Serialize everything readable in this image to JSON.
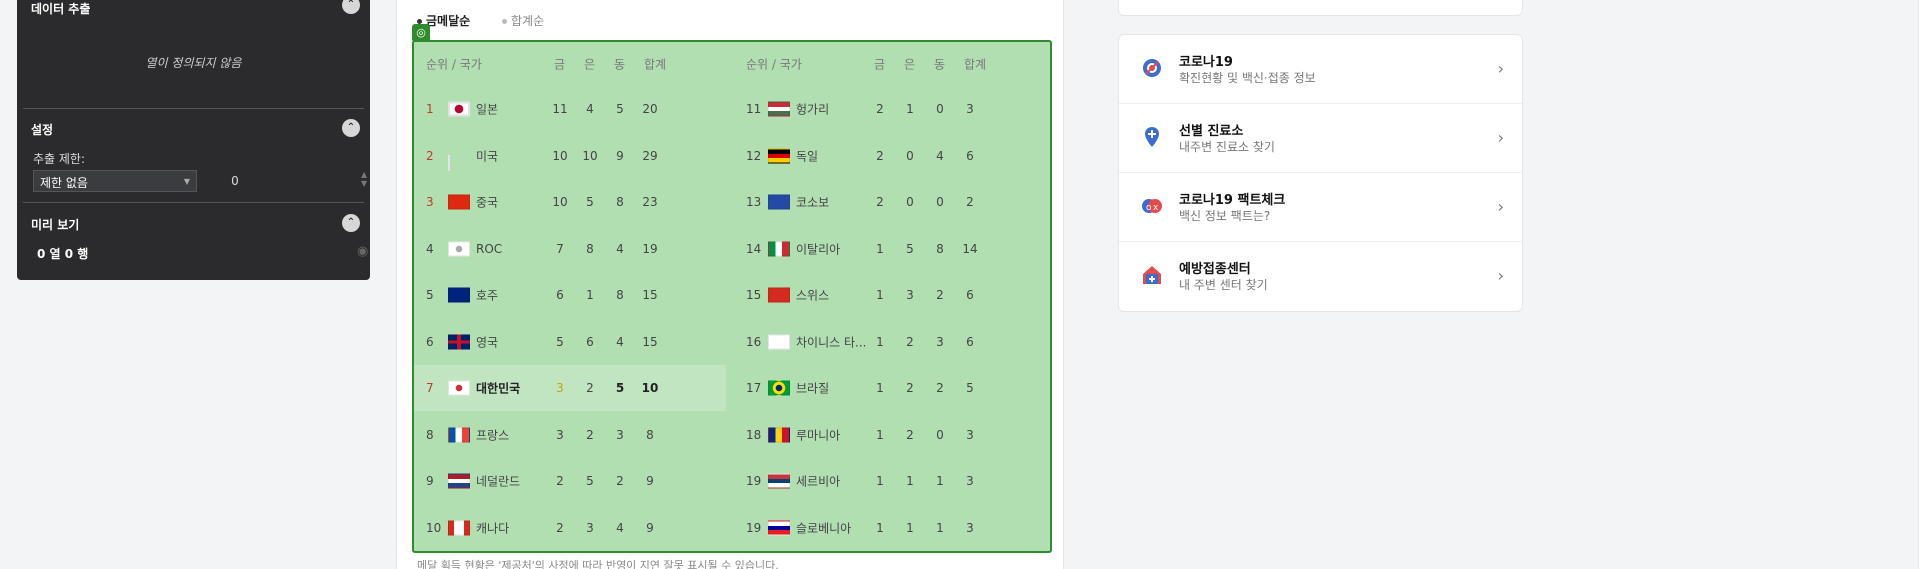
{
  "panel": {
    "extract_title": "데이터 추출",
    "empty_text": "열이 정의되지 않음",
    "settings_title": "설정",
    "limit_label": "추출 제한:",
    "limit_value": "제한 없음",
    "limit_number": "0",
    "preview_title": "미리 보기",
    "preview_counts": "0 열  0 행"
  },
  "tabs": {
    "gold": "금메달순",
    "total": "합계순"
  },
  "table": {
    "headers": {
      "rank_country": "순위 / 국가",
      "gold": "금",
      "silver": "은",
      "bronze": "동",
      "total": "합계"
    },
    "left": [
      {
        "rank": "1",
        "country": "일본",
        "gold": "11",
        "silver": "4",
        "bronze": "5",
        "total": "20"
      },
      {
        "rank": "2",
        "country": "미국",
        "gold": "10",
        "silver": "10",
        "bronze": "9",
        "total": "29"
      },
      {
        "rank": "3",
        "country": "중국",
        "gold": "10",
        "silver": "5",
        "bronze": "8",
        "total": "23"
      },
      {
        "rank": "4",
        "country": "ROC",
        "gold": "7",
        "silver": "8",
        "bronze": "4",
        "total": "19"
      },
      {
        "rank": "5",
        "country": "호주",
        "gold": "6",
        "silver": "1",
        "bronze": "8",
        "total": "15"
      },
      {
        "rank": "6",
        "country": "영국",
        "gold": "5",
        "silver": "6",
        "bronze": "4",
        "total": "15"
      },
      {
        "rank": "7",
        "country": "대한민국",
        "gold": "3",
        "silver": "2",
        "bronze": "5",
        "total": "10"
      },
      {
        "rank": "8",
        "country": "프랑스",
        "gold": "3",
        "silver": "2",
        "bronze": "3",
        "total": "8"
      },
      {
        "rank": "9",
        "country": "네덜란드",
        "gold": "2",
        "silver": "5",
        "bronze": "2",
        "total": "9"
      },
      {
        "rank": "10",
        "country": "캐나다",
        "gold": "2",
        "silver": "3",
        "bronze": "4",
        "total": "9"
      }
    ],
    "right": [
      {
        "rank": "11",
        "country": "헝가리",
        "gold": "2",
        "silver": "1",
        "bronze": "0",
        "total": "3"
      },
      {
        "rank": "12",
        "country": "독일",
        "gold": "2",
        "silver": "0",
        "bronze": "4",
        "total": "6"
      },
      {
        "rank": "13",
        "country": "코소보",
        "gold": "2",
        "silver": "0",
        "bronze": "0",
        "total": "2"
      },
      {
        "rank": "14",
        "country": "이탈리아",
        "gold": "1",
        "silver": "5",
        "bronze": "8",
        "total": "14"
      },
      {
        "rank": "15",
        "country": "스위스",
        "gold": "1",
        "silver": "3",
        "bronze": "2",
        "total": "6"
      },
      {
        "rank": "16",
        "country": "차이니스 타...",
        "gold": "1",
        "silver": "2",
        "bronze": "3",
        "total": "6"
      },
      {
        "rank": "17",
        "country": "브라질",
        "gold": "1",
        "silver": "2",
        "bronze": "2",
        "total": "5"
      },
      {
        "rank": "18",
        "country": "루마니아",
        "gold": "1",
        "silver": "2",
        "bronze": "0",
        "total": "3"
      },
      {
        "rank": "19",
        "country": "세르비아",
        "gold": "1",
        "silver": "1",
        "bronze": "1",
        "total": "3"
      },
      {
        "rank": "19",
        "country": "슬로베니아",
        "gold": "1",
        "silver": "1",
        "bronze": "1",
        "total": "3"
      }
    ]
  },
  "footnote": "메달 획득 현황은 '제공처'의 사정에 따라 반영이 지연 잘못 표시될 수 있습니다.",
  "links": [
    {
      "title": "코로나19",
      "sub": "확진현황 및 백신·접종 정보",
      "icon": "covid-icon"
    },
    {
      "title": "선별 진료소",
      "sub": "내주변 진료소 찾기",
      "icon": "location-plus-icon"
    },
    {
      "title": "코로나19 팩트체크",
      "sub": "백신 정보 팩트는?",
      "icon": "factcheck-icon"
    },
    {
      "title": "예방접종센터",
      "sub": "내 주변 센터 찾기",
      "icon": "clinic-icon"
    }
  ]
}
